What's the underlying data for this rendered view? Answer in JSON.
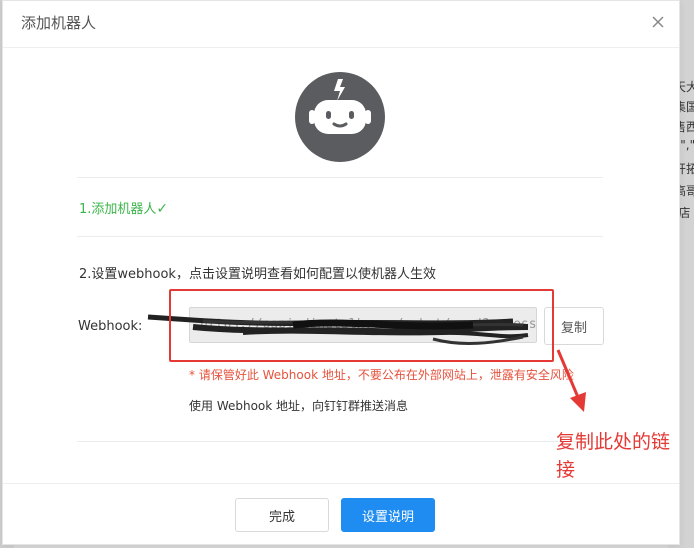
{
  "dialog": {
    "title": "添加机器人",
    "close_icon": "close-icon",
    "bot_icon": "robot-icon"
  },
  "step1": {
    "label": "1.添加机器人",
    "check": "✓"
  },
  "step2": {
    "label": "2.设置webhook，点击设置说明查看如何配置以使机器人生效",
    "webhook_label": "Webhook:",
    "webhook_value": "https://oapi.dingtalk.com/robot/send?access_token=",
    "copy_label": "复制",
    "warning": "* 请保管好此 Webhook 地址，不要公布在外部网站上，泄露有安全风险",
    "note": "使用 Webhook 地址，向钉钉群推送消息"
  },
  "footer": {
    "done_label": "完成",
    "setup_label": "设置说明"
  },
  "annotation": {
    "text": "复制此处的链接"
  },
  "background": {
    "right_text": [
      "天大",
      "集国",
      "售西",
      "s\",\"",
      "开拓",
      "高哥",
      "-店"
    ]
  },
  "colors": {
    "accent": "#1e8cf0",
    "success": "#3bb54a",
    "warning": "#e5533d",
    "annotation": "#e53935",
    "avatar": "#5a5c5f"
  }
}
